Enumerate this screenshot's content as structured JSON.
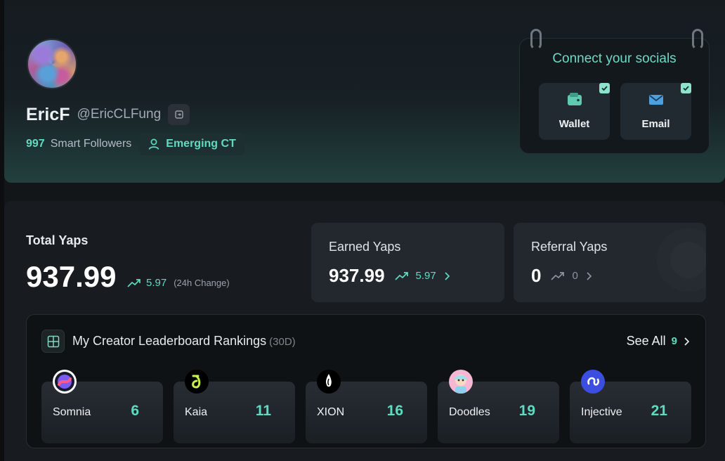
{
  "profile": {
    "display_name": "EricF",
    "handle": "@EricCLFung",
    "smart_followers_count": "997",
    "smart_followers_label": "Smart Followers",
    "badge_label": "Emerging CT"
  },
  "socials": {
    "title": "Connect your socials",
    "items": [
      {
        "label": "Wallet",
        "connected": true,
        "icon": "wallet-icon"
      },
      {
        "label": "Email",
        "connected": true,
        "icon": "mail-icon"
      }
    ]
  },
  "yaps": {
    "total_label": "Total Yaps",
    "total_value": "937.99",
    "total_change": "5.97",
    "total_change_note": "(24h Change)",
    "earned_label": "Earned Yaps",
    "earned_value": "937.99",
    "earned_change": "5.97",
    "referral_label": "Referral Yaps",
    "referral_value": "0",
    "referral_change": "0"
  },
  "leaderboard": {
    "title": "My Creator Leaderboard Rankings",
    "period": "(30D)",
    "see_all_label": "See All",
    "see_all_count": "9",
    "rankings": [
      {
        "name": "Somnia",
        "rank": "6"
      },
      {
        "name": "Kaia",
        "rank": "11"
      },
      {
        "name": "XION",
        "rank": "16"
      },
      {
        "name": "Doodles",
        "rank": "19"
      },
      {
        "name": "Injective",
        "rank": "21"
      }
    ]
  },
  "colors": {
    "accent": "#5fdcc0",
    "background": "#131619",
    "card": "#22282e"
  }
}
